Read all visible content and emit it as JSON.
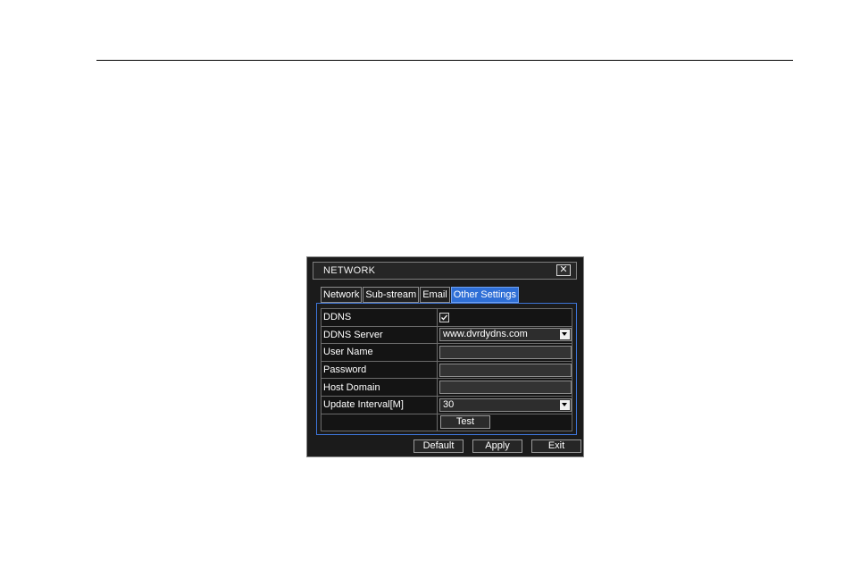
{
  "dialog": {
    "title": "NETWORK",
    "close_glyph": "✕",
    "tabs": [
      {
        "label": "Network",
        "active": false
      },
      {
        "label": "Sub-stream",
        "active": false
      },
      {
        "label": "Email",
        "active": false
      },
      {
        "label": "Other Settings",
        "active": true
      }
    ],
    "rows": {
      "ddns": {
        "label": "DDNS",
        "checked": true
      },
      "ddns_server": {
        "label": "DDNS Server",
        "value": "www.dvrdydns.com"
      },
      "user_name": {
        "label": "User Name",
        "value": ""
      },
      "password": {
        "label": "Password",
        "value": ""
      },
      "host_domain": {
        "label": "Host Domain",
        "value": ""
      },
      "update_interval": {
        "label": "Update Interval[M]",
        "value": "30"
      }
    },
    "test_label": "Test",
    "buttons": {
      "default_label": "Default",
      "apply_label": "Apply",
      "exit_label": "Exit"
    },
    "colors": {
      "active_tab": "#2f6fd6",
      "panel_border": "#3d74d6",
      "background": "#1b1b1b"
    },
    "icons": [
      "close-icon",
      "checkmark-icon",
      "chevron-down-icon"
    ]
  }
}
